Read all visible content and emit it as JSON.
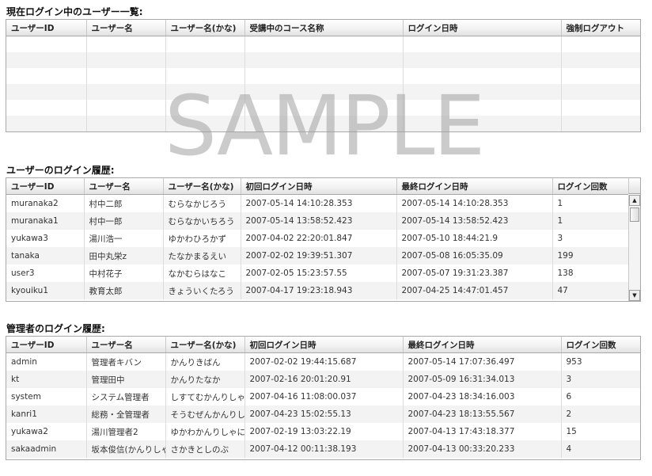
{
  "sections": {
    "current": {
      "title": "現在ログイン中のユーザー一覧:",
      "headers": [
        "ユーザーID",
        "ユーザー名",
        "ユーザー名(かな)",
        "受講中のコース名称",
        "ログイン日時",
        "強制ログアウト"
      ]
    },
    "user_history": {
      "title": "ユーザーのログイン履歴:",
      "headers": [
        "ユーザーID",
        "ユーザー名",
        "ユーザー名(かな)",
        "初回ログイン日時",
        "最終ログイン日時",
        "ログイン回数"
      ],
      "rows": [
        [
          "muranaka2",
          "村中二郎",
          "むらなかじろう",
          "2007-05-14 14:10:28.353",
          "2007-05-14 14:10:28.353",
          "1"
        ],
        [
          "muranaka1",
          "村中一郎",
          "むらなかいちろう",
          "2007-05-14 13:58:52.423",
          "2007-05-14 13:58:52.423",
          "1"
        ],
        [
          "yukawa3",
          "湯川浩一",
          "ゆかわひろかず",
          "2007-04-02 22:20:01.847",
          "2007-05-10 18:44:21.9",
          "3"
        ],
        [
          "tanaka",
          "田中丸栄z",
          "たなかまるえい",
          "2007-02-02 19:39:51.307",
          "2007-05-08 16:05:35.09",
          "199"
        ],
        [
          "user3",
          "中村花子",
          "なかむらはなこ",
          "2007-02-05 15:23:57.55",
          "2007-05-07 19:31:23.387",
          "138"
        ],
        [
          "kyouiku1",
          "教育太郎",
          "きょういくたろう",
          "2007-04-17 19:23:18.943",
          "2007-04-25 14:47:01.457",
          "47"
        ]
      ]
    },
    "admin_history": {
      "title": "管理者のログイン履歴:",
      "headers": [
        "ユーザーID",
        "ユーザー名",
        "ユーザー名(かな)",
        "初回ログイン日時",
        "最終ログイン日時",
        "ログイン回数"
      ],
      "rows": [
        [
          "admin",
          "管理者キバン",
          "かんりきばん",
          "2007-02-02 19:44:15.687",
          "2007-05-14 17:07:36.497",
          "953"
        ],
        [
          "kt",
          "管理田中",
          "かんりたなか",
          "2007-02-16 20:01:20.91",
          "2007-05-09 16:31:34.013",
          "3"
        ],
        [
          "system",
          "システム管理者",
          "しすてむかんりしゃ",
          "2007-04-16 11:08:00.037",
          "2007-04-23 18:34:16.003",
          "6"
        ],
        [
          "kanri1",
          "総務・全管理者",
          "そうむぜんかんりしゃ",
          "2007-04-23 15:02:55.13",
          "2007-04-23 18:13:55.567",
          "2"
        ],
        [
          "yukawa2",
          "湯川管理者2",
          "ゆかわかんりしゃに",
          "2007-02-19 13:03:22.19",
          "2007-04-13 17:43:18.377",
          "15"
        ],
        [
          "sakaadmin",
          "坂本俊信(かんりしゃ)",
          "さかきとしのぶ",
          "2007-04-12 00:11:38.193",
          "2007-04-13 00:33:20.233",
          "4"
        ]
      ]
    }
  },
  "scrollbar": {
    "up_arrow": "▲",
    "down_arrow": "▼"
  },
  "watermark": "SAMPLE"
}
